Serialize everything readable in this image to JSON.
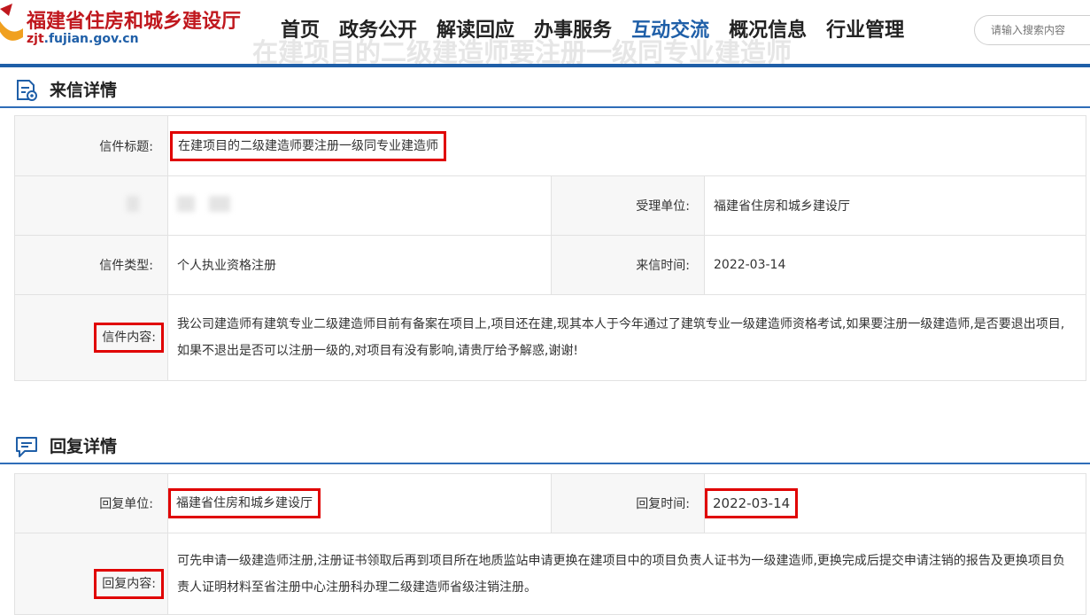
{
  "header": {
    "site_name": "福建省住房和城乡建设厅",
    "site_url_prefix": "zjt",
    "site_url_suffix": ".fujian.gov.cn",
    "nav": [
      "首页",
      "政务公开",
      "解读回应",
      "办事服务",
      "互动交流",
      "概况信息",
      "行业管理"
    ],
    "active_nav": "互动交流",
    "search_placeholder": "请输入搜索内容",
    "ghost_title": "在建项目的二级建造师要注册一级同专业建造师"
  },
  "letter": {
    "section_title": "来信详情",
    "title_label": "信件标题:",
    "title_value": "在建项目的二级建造师要注册一级同专业建造师",
    "unit_label": "受理单位:",
    "unit_value": "福建省住房和城乡建设厅",
    "type_label": "信件类型:",
    "type_value": "个人执业资格注册",
    "time_label": "来信时间:",
    "time_value": "2022-03-14",
    "content_label": "信件内容:",
    "content_value": "我公司建造师有建筑专业二级建造师目前有备案在项目上,项目还在建,现其本人于今年通过了建筑专业一级建造师资格考试,如果要注册一级建造师,是否要退出项目,如果不退出是否可以注册一级的,对项目有没有影响,请贵厅给予解惑,谢谢!"
  },
  "reply": {
    "section_title": "回复详情",
    "unit_label": "回复单位:",
    "unit_value": "福建省住房和城乡建设厅",
    "time_label": "回复时间:",
    "time_value": "2022-03-14",
    "content_label": "回复内容:",
    "content_value": "可先申请一级建造师注册,注册证书领取后再到项目所在地质监站申请更换在建项目中的项目负责人证书为一级建造师,更换完成后提交申请注销的报告及更换项目负责人证明材料至省注册中心注册科办理二级建造师省级注销注册。"
  },
  "colors": {
    "brand_red": "#c0181e",
    "brand_blue": "#1f5fa8",
    "highlight_box": "#e00000"
  },
  "icons": [
    "logo-mark-icon",
    "letter-detail-icon",
    "reply-detail-icon"
  ]
}
